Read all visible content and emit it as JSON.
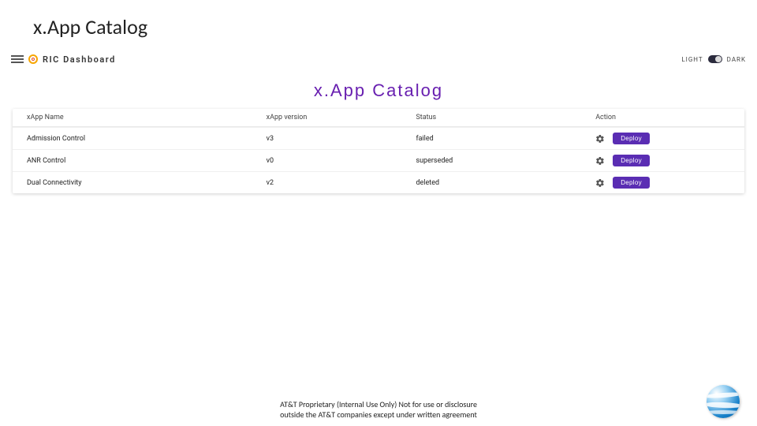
{
  "slide": {
    "title": "x.App Catalog"
  },
  "topbar": {
    "brand": "RIC Dashboard",
    "theme": {
      "light": "LIGHT",
      "dark": "DARK"
    }
  },
  "page": {
    "heading": "x.App Catalog"
  },
  "table": {
    "headers": {
      "name": "xApp Name",
      "version": "xApp version",
      "status": "Status",
      "action": "Action"
    },
    "rows": [
      {
        "name": "Admission Control",
        "version": "v3",
        "status": "failed",
        "action": "Deploy"
      },
      {
        "name": "ANR Control",
        "version": "v0",
        "status": "superseded",
        "action": "Deploy"
      },
      {
        "name": "Dual Connectivity",
        "version": "v2",
        "status": "deleted",
        "action": "Deploy"
      }
    ]
  },
  "footer": {
    "line1": "AT&T Proprietary (Internal Use Only) Not for use or disclosure",
    "line2": "outside the AT&T companies except under written agreement"
  }
}
